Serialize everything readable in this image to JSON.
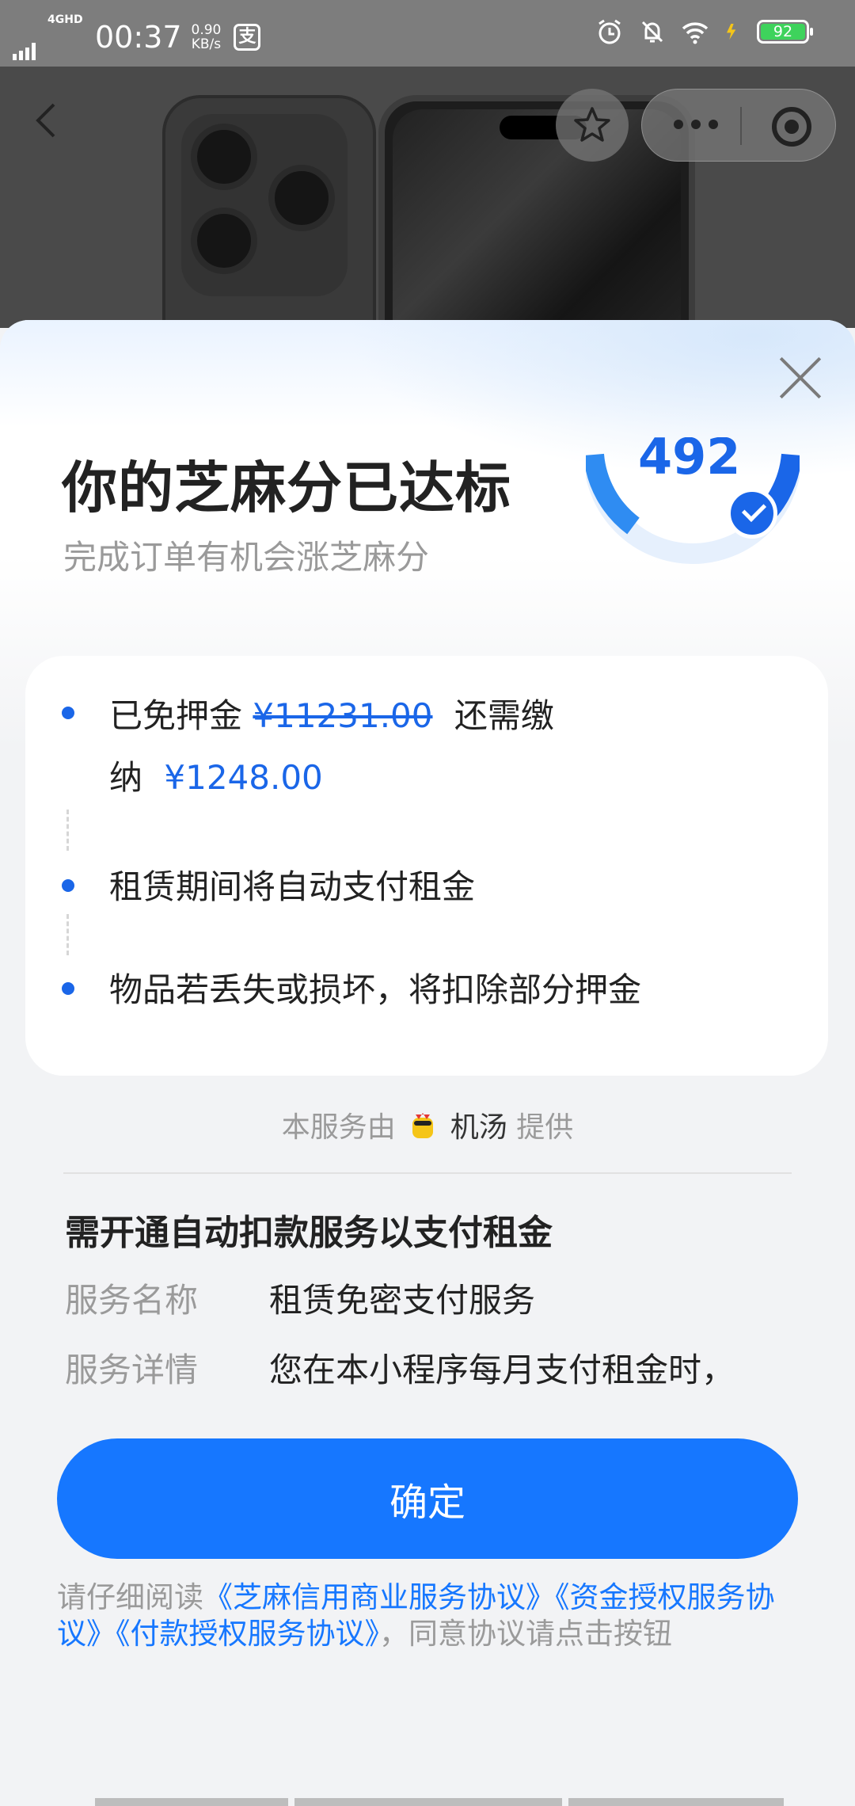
{
  "status_bar": {
    "network": "4GHD",
    "time": "00:37",
    "speed_value": "0.90",
    "speed_unit": "KB/s",
    "app_glyph": "支",
    "battery": "92",
    "icons": [
      "alarm-icon",
      "mute-icon",
      "wifi-icon",
      "charging-icon"
    ]
  },
  "nav": {
    "back_icon": "back-icon",
    "favorite_icon": "star-icon",
    "more_icon": "more-icon",
    "close_app_icon": "target-icon"
  },
  "sheet": {
    "title": "你的芝麻分已达标",
    "subtitle": "完成订单有机会涨芝麻分",
    "score": "492",
    "card": {
      "item1_prefix": "已免押金",
      "item1_original_price": "¥11231.00",
      "item1_suffix": "还需缴",
      "item1_line2_prefix": "纳",
      "item1_due_price": "¥1248.00",
      "item2": "租赁期间将自动支付租金",
      "item3": "物品若丢失或损坏，将扣除部分押金"
    },
    "provider_prefix": "本服务由",
    "provider_name": "机汤",
    "provider_suffix": "提供",
    "section_title": "需开通自动扣款服务以支付租金",
    "rows": [
      {
        "label": "服务名称",
        "value": "租赁免密支付服务"
      },
      {
        "label": "服务详情",
        "value": "您在本小程序每月支付租金时，"
      }
    ],
    "confirm_label": "确定",
    "agreement_prefix": "请仔细阅读",
    "agreement_link1": "《芝麻信用商业服务协议》",
    "agreement_link2": "《资金授权服务协议》",
    "agreement_link3": "《付款授权服务协议》",
    "agreement_suffix": "，同意协议请点击按钮"
  },
  "colors": {
    "accent": "#1677ff",
    "score_blue": "#1a66e8",
    "muted_text": "#9a9a9a"
  }
}
